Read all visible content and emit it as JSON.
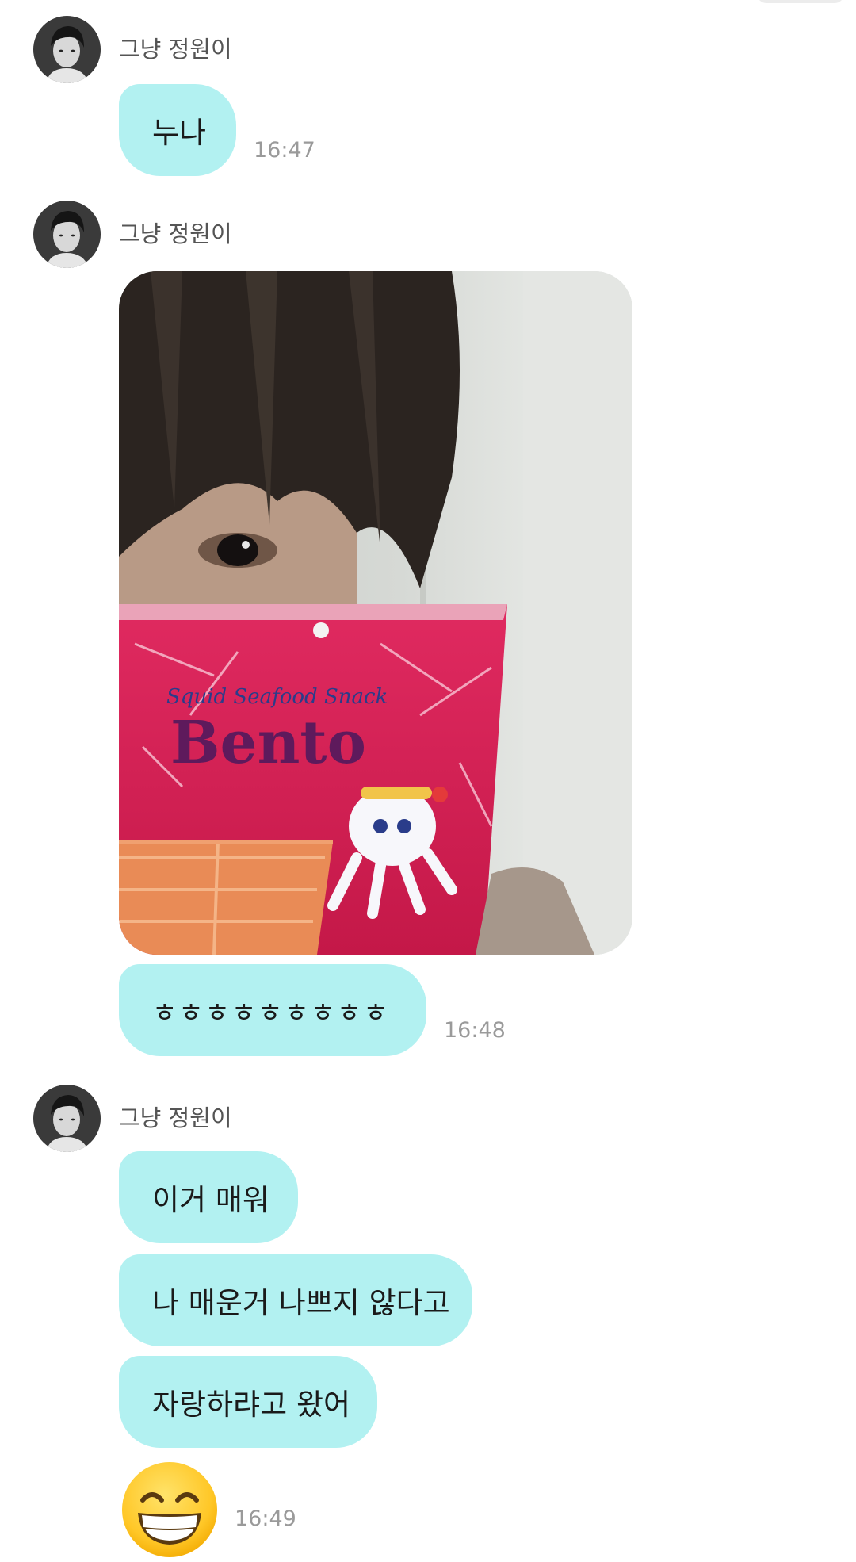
{
  "chat": {
    "groups": [
      {
        "sender": "그냥 정원이",
        "messages": [
          {
            "type": "text",
            "text": "누나"
          }
        ],
        "time": "16:47"
      },
      {
        "sender": "그냥 정원이",
        "messages": [
          {
            "type": "image",
            "description": "snack-photo"
          },
          {
            "type": "text",
            "text": "ㅎㅎㅎㅎㅎㅎㅎㅎㅎ"
          }
        ],
        "time": "16:48"
      },
      {
        "sender": "그냥 정원이",
        "messages": [
          {
            "type": "text",
            "text": "이거 매워"
          },
          {
            "type": "text",
            "text": "나 매운거 나쁘지 않다고"
          },
          {
            "type": "text",
            "text": "자랑하랴고 왔어"
          },
          {
            "type": "emoji",
            "emoji": "grinning-face-with-smiling-eyes"
          }
        ],
        "time": "16:49"
      }
    ]
  },
  "photo": {
    "package_text": {
      "brand": "Bento",
      "subtitle": "Squid Seafood Snack"
    }
  },
  "colors": {
    "bubble": "#b2f1f1",
    "timestamp": "#9a9a9a",
    "sender": "#555555",
    "background": "#ffffff",
    "package": "#d31f55"
  }
}
